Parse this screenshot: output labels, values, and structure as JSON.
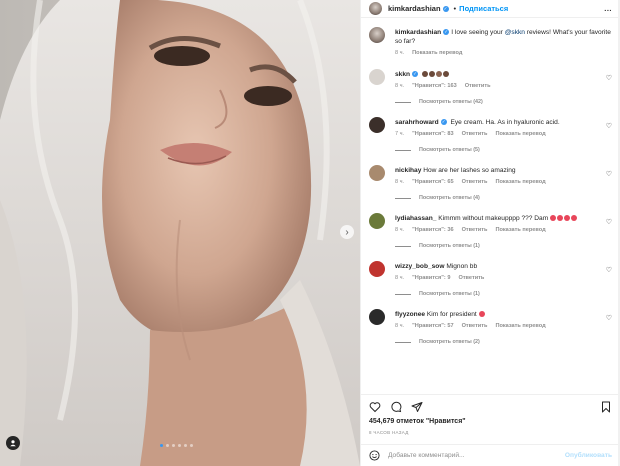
{
  "header": {
    "username": "kimkardashian",
    "separator": "•",
    "follow_label": "Подписаться",
    "more_label": "..."
  },
  "caption": {
    "username": "kimkardashian",
    "text_before": "I love seeing your ",
    "mention": "@skkn",
    "text_after": " reviews! What's your favorite so far?",
    "time": "8 ч.",
    "translate": "Показать перевод"
  },
  "comments": [
    {
      "username": "skkn",
      "verified": true,
      "text": "",
      "emojis": [
        "#6b4a3a",
        "#6b4a3a",
        "#8a6350",
        "#6b4a3a"
      ],
      "time": "8 ч.",
      "likes": "\"Нравится\": 163",
      "reply": "Ответить",
      "translate": "",
      "replies": "Посмотреть ответы (42)",
      "avatar_color": "#d9d4cf"
    },
    {
      "username": "sarahrhoward",
      "verified": true,
      "text": "Eye cream. Ha. As in hyaluronic acid.",
      "emojis": [],
      "time": "7 ч.",
      "likes": "\"Нравится\": 83",
      "reply": "Ответить",
      "translate": "Показать перевод",
      "replies": "Посмотреть ответы (5)",
      "avatar_color": "#3b2f2a"
    },
    {
      "username": "nickihay",
      "verified": false,
      "text": "How are her lashes so amazing",
      "emojis": [],
      "time": "8 ч.",
      "likes": "\"Нравится\": 65",
      "reply": "Ответить",
      "translate": "Показать перевод",
      "replies": "Посмотреть ответы (4)",
      "avatar_color": "#a88a6e"
    },
    {
      "username": "lydiahassan_",
      "verified": false,
      "text": "Kimmm without makeupppp ??? Dam",
      "emojis": [
        "#e8465a",
        "#e8465a",
        "#e8465a",
        "#e8465a"
      ],
      "time": "8 ч.",
      "likes": "\"Нравится\": 36",
      "reply": "Ответить",
      "translate": "Показать перевод",
      "replies": "Посмотреть ответы (1)",
      "avatar_color": "#6b7a3a"
    },
    {
      "username": "wizzy_bob_sow",
      "verified": false,
      "text": "Mignon bb",
      "emojis": [],
      "time": "8 ч.",
      "likes": "\"Нравится\": 9",
      "reply": "Ответить",
      "translate": "",
      "replies": "Посмотреть ответы (1)",
      "avatar_color": "#c0342f"
    },
    {
      "username": "flyyzonee",
      "verified": false,
      "text": "Kim for president",
      "emojis": [
        "#e8465a"
      ],
      "time": "8 ч.",
      "likes": "\"Нравится\": 57",
      "reply": "Ответить",
      "translate": "Показать перевод",
      "replies": "Посмотреть ответы (2)",
      "avatar_color": "#2a2a2a"
    }
  ],
  "footer": {
    "likes": "454,679 отметок \"Нравится\"",
    "time": "8 ЧАСОВ НАЗАД",
    "comment_placeholder": "Добавьте комментарий...",
    "post_label": "Опубликовать"
  },
  "icons": {
    "heart": "heart-icon",
    "comment": "comment-icon",
    "share": "share-icon",
    "save": "bookmark-icon",
    "emoji": "smile-icon",
    "next": "chevron-right-icon",
    "tag": "user-tag-icon"
  },
  "colors": {
    "accent": "#0095f6",
    "verified": "#3897f0",
    "muted": "#8e8e8e"
  },
  "carousel": {
    "count": 6,
    "active": 1
  }
}
